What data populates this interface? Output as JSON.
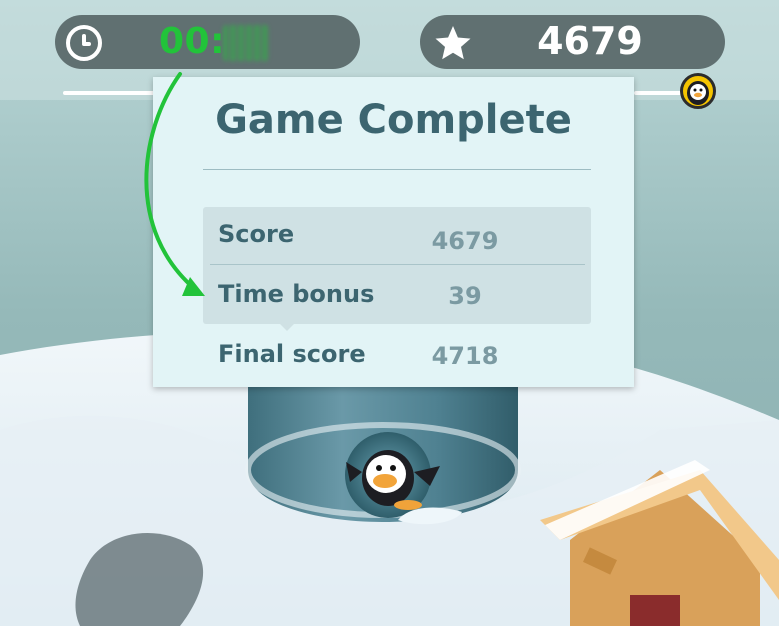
{
  "hud": {
    "timer_visible_text": "00:",
    "score": "4679"
  },
  "dialog": {
    "title": "Game Complete",
    "rows": [
      {
        "label": "Score",
        "value": "4679"
      },
      {
        "label": "Time bonus",
        "value": "39"
      },
      {
        "label": "Final score",
        "value": "4718"
      }
    ]
  },
  "colors": {
    "timer_green": "#22c33a",
    "hud_pill": "#586768",
    "dialog_bg": "#e2f4f6",
    "dialog_text": "#3c6570",
    "value_text": "#7b9aa2",
    "arrow_green": "#22c33a",
    "marker_yellow": "#f5c400"
  },
  "icons": [
    "clock-icon",
    "star-icon",
    "penguin-progress-marker-icon"
  ]
}
